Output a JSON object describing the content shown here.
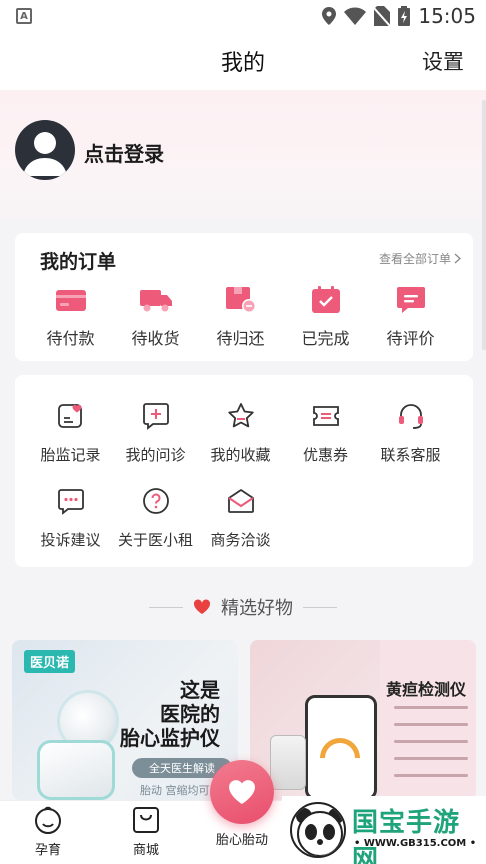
{
  "status_bar": {
    "time": "15:05"
  },
  "header": {
    "title": "我的",
    "settings": "设置"
  },
  "profile": {
    "login_text": "点击登录"
  },
  "orders": {
    "title": "我的订单",
    "view_all": "查看全部订单",
    "items": [
      {
        "label": "待付款",
        "icon": "wallet-icon"
      },
      {
        "label": "待收货",
        "icon": "truck-icon"
      },
      {
        "label": "待归还",
        "icon": "return-box-icon"
      },
      {
        "label": "已完成",
        "icon": "calendar-check-icon"
      },
      {
        "label": "待评价",
        "icon": "comment-icon"
      }
    ]
  },
  "services": {
    "items": [
      {
        "label": "胎监记录",
        "icon": "heart-record-icon"
      },
      {
        "label": "我的问诊",
        "icon": "consult-plus-icon"
      },
      {
        "label": "我的收藏",
        "icon": "star-icon"
      },
      {
        "label": "优惠券",
        "icon": "coupon-icon"
      },
      {
        "label": "联系客服",
        "icon": "headset-icon"
      },
      {
        "label": "投诉建议",
        "icon": "feedback-icon"
      },
      {
        "label": "关于医小租",
        "icon": "question-icon"
      },
      {
        "label": "商务洽谈",
        "icon": "mail-icon"
      }
    ]
  },
  "featured": {
    "title": "精选好物",
    "products": [
      {
        "brand": "医贝诺",
        "headline_1": "这是",
        "headline_2": "医院的",
        "headline_3": "胎心监护仪",
        "pill": "全天医生解读",
        "sub": "胎动 宫缩均可"
      },
      {
        "headline": "黄疸检测仪"
      }
    ]
  },
  "tabbar": {
    "tabs": [
      {
        "label": "孕育",
        "icon": "baby-face-icon"
      },
      {
        "label": "商城",
        "icon": "shopping-bag-icon"
      },
      {
        "label": "胎心胎动",
        "icon": "heart-icon"
      }
    ]
  },
  "watermark": {
    "name": "国宝手游网",
    "url": "• WWW.GB315.COM •"
  },
  "colors": {
    "accent": "#e94e6c",
    "icon_pink": "#ee5a7a",
    "background": "#f4f4f6"
  }
}
